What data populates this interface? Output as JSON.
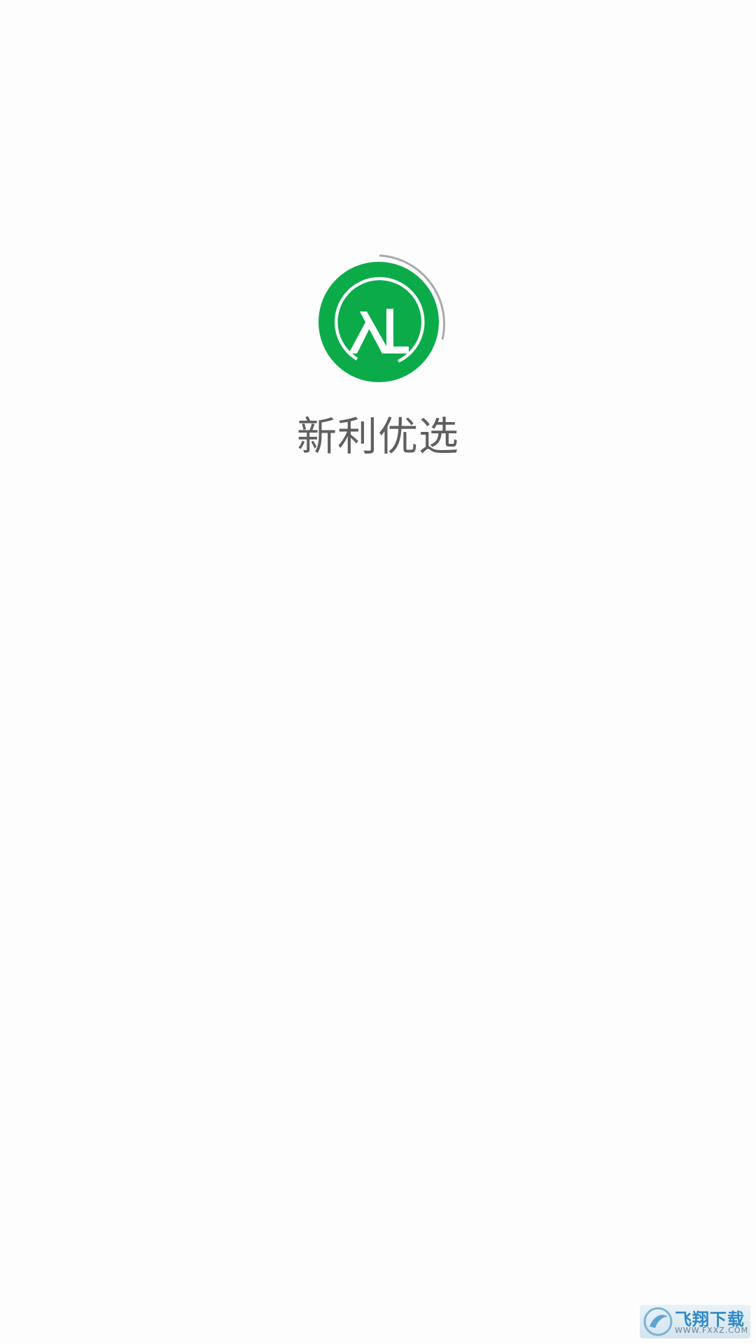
{
  "splash": {
    "app_name": "新利优选",
    "logo_letters": "XL",
    "brand_color": "#0bab4a",
    "loading_indicator": "spinner-arc"
  },
  "watermark": {
    "title": "飞翔下载",
    "domain": "WWW.FXXZ.COM"
  }
}
